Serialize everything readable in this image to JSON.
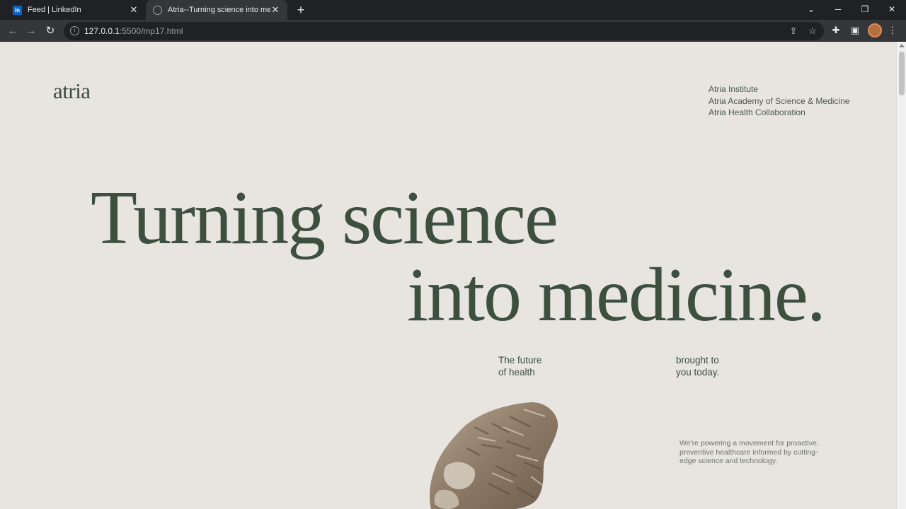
{
  "browser": {
    "tabs": [
      {
        "title": "Feed | LinkedIn",
        "favicon": "linkedin-icon"
      },
      {
        "title": "Atria--Turning science into medicine",
        "favicon": "globe-icon"
      }
    ],
    "url_host": "127.0.0.1",
    "url_rest": ":5500/mp17.html"
  },
  "site": {
    "logo": "atria",
    "nav": [
      "Atria Institute",
      "Atria Academy of Science & Medicine",
      "Atria Health Collaboration"
    ],
    "headline_line1": "Turning science",
    "headline_line2": "into medicine.",
    "subtitle_left": "The future\nof health",
    "subtitle_right": "brought to\nyou today.",
    "description": "We're powering a movement for proactive,\npreventive healthcare informed by cutting-\nedge science and technology."
  },
  "colors": {
    "background": "#e8e4df",
    "text_green": "#3d4f3f"
  }
}
